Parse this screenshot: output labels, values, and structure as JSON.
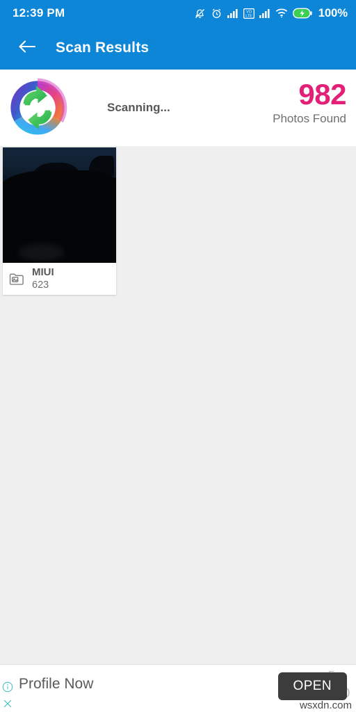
{
  "status_bar": {
    "time": "12:39 PM",
    "battery_percent": "100%",
    "icons": [
      "mute-bell-icon",
      "alarm-clock-icon",
      "signal-bars-sim1-icon",
      "volte-icon",
      "signal-bars-sim2-icon",
      "wifi-icon",
      "battery-charging-icon"
    ]
  },
  "app_bar": {
    "back_label": "back-arrow",
    "title": "Scan Results",
    "background_color": "#0D86D8"
  },
  "scan_summary": {
    "logo_name": "recycle-sync-logo",
    "status_text": "Scanning...",
    "count": "982",
    "count_label": "Photos Found",
    "count_color": "#E31F77"
  },
  "results": {
    "folders": [
      {
        "name": "MIUI",
        "count": "623",
        "icon": "photo-folder-icon"
      }
    ]
  },
  "ad_banner": {
    "info_icon": "info-icon",
    "close_icon": "close-icon",
    "headline": "Profile Now",
    "sub_small": "Fac",
    "sub_big": "Co",
    "open_label": "OPEN",
    "open_bg_color": "#3C3C3C",
    "watermark": "wsxdn.com"
  }
}
